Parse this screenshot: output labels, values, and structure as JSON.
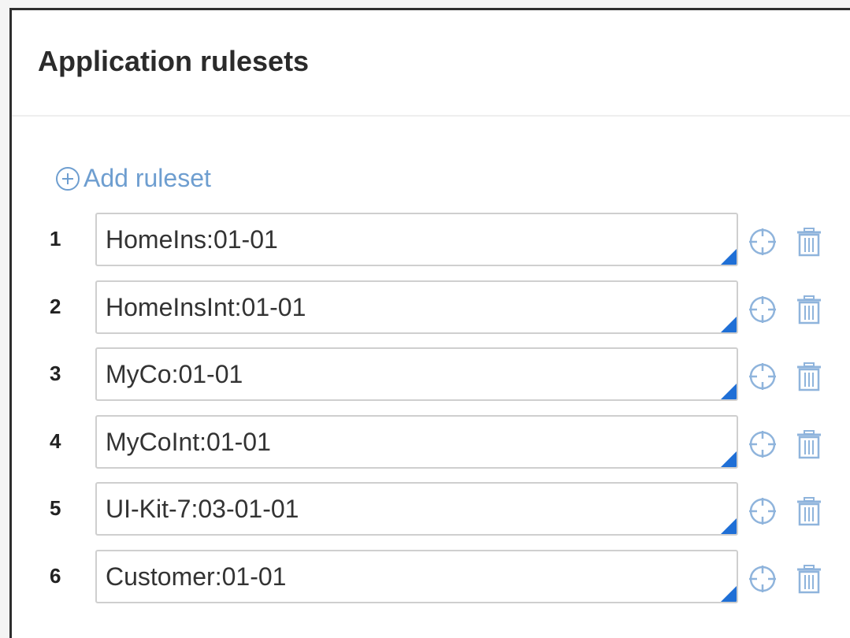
{
  "panel": {
    "title": "Application rulesets",
    "add_label": "Add ruleset"
  },
  "rulesets": [
    {
      "num": "1",
      "value": "HomeIns:01-01"
    },
    {
      "num": "2",
      "value": "HomeInsInt:01-01"
    },
    {
      "num": "3",
      "value": "MyCo:01-01"
    },
    {
      "num": "4",
      "value": "MyCoInt:01-01"
    },
    {
      "num": "5",
      "value": "UI-Kit-7:03-01-01"
    },
    {
      "num": "6",
      "value": "Customer:01-01"
    }
  ],
  "icons": {
    "add": "plus-circle-icon",
    "open": "crosshair-icon",
    "delete": "trash-icon",
    "dropdown": "corner-triangle-icon"
  },
  "colors": {
    "link": "#6e9ed0",
    "icon": "#8fb4dc",
    "corner": "#1f6fd6",
    "border": "#cfcfcf"
  }
}
